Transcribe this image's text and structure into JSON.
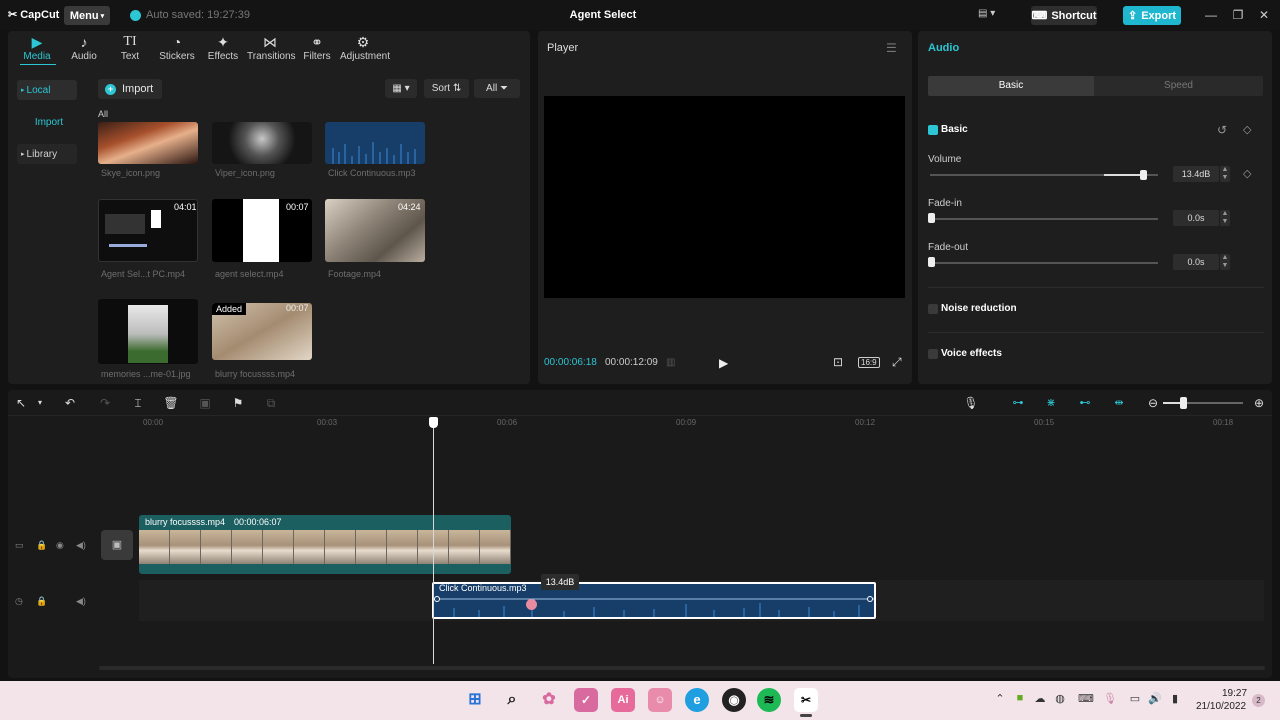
{
  "titlebar": {
    "app_name": "CapCut",
    "menu_label": "Menu",
    "autosave": "Auto saved: 19:27:39",
    "project_title": "Agent Select",
    "shortcut_label": "Shortcut",
    "export_label": "Export",
    "colors": {
      "accent": "#2cc6d4",
      "export": "#1fb6cf"
    }
  },
  "tool_tabs": [
    {
      "label": "Media",
      "icon": "media-icon"
    },
    {
      "label": "Audio",
      "icon": "audio-icon"
    },
    {
      "label": "Text",
      "icon": "text-icon"
    },
    {
      "label": "Stickers",
      "icon": "stickers-icon"
    },
    {
      "label": "Effects",
      "icon": "effects-icon"
    },
    {
      "label": "Transitions",
      "icon": "transitions-icon"
    },
    {
      "label": "Filters",
      "icon": "filters-icon"
    },
    {
      "label": "Adjustment",
      "icon": "adjustment-icon"
    }
  ],
  "sidenav": {
    "local": "Local",
    "import": "Import",
    "library": "Library"
  },
  "media": {
    "import_label": "Import",
    "sort_label": "Sort",
    "filter_label": "All",
    "all_label": "All",
    "items": [
      {
        "name": "Skye_icon.png",
        "duration": ""
      },
      {
        "name": "Viper_icon.png",
        "duration": ""
      },
      {
        "name": "Click Continuous.mp3",
        "duration": ""
      },
      {
        "name": "Agent Sel...t PC.mp4",
        "duration": "04:01"
      },
      {
        "name": "agent select.mp4",
        "duration": "00:07"
      },
      {
        "name": "Footage.mp4",
        "duration": "04:24"
      },
      {
        "name": "memories ...me-01.jpg",
        "duration": ""
      },
      {
        "name": "blurry focussss.mp4",
        "duration": "00:07",
        "badge": "Added"
      }
    ]
  },
  "player": {
    "title": "Player",
    "current_time": "00:00:06:18",
    "total_time": "00:00:12:09",
    "ratio": "16:9"
  },
  "audio_panel": {
    "title": "Audio",
    "tabs": [
      "Basic",
      "Speed"
    ],
    "basic_label": "Basic",
    "volume_label": "Volume",
    "volume_value": "13.4dB",
    "volume_level": 0.94,
    "fadein_label": "Fade-in",
    "fadein_value": "0.0s",
    "fadeout_label": "Fade-out",
    "fadeout_value": "0.0s",
    "noise_label": "Noise reduction",
    "voice_label": "Voice effects"
  },
  "timeline": {
    "ruler": [
      "00:00",
      "00:03",
      "00:06",
      "00:09",
      "00:12",
      "00:15",
      "00:18"
    ],
    "video_clip": {
      "name": "blurry focussss.mp4",
      "duration": "00:00:06:07"
    },
    "audio_clip": {
      "name": "Click Continuous.mp3"
    },
    "volume_tooltip": "13.4dB"
  },
  "taskbar": {
    "time": "19:27",
    "date": "21/10/2022",
    "notifications": "2",
    "apps": [
      "windows-start-icon",
      "search-icon",
      "app-icon",
      "app-icon",
      "ai-icon",
      "discord-icon",
      "edge-icon",
      "obs-icon",
      "spotify-icon",
      "capcut-icon"
    ]
  }
}
